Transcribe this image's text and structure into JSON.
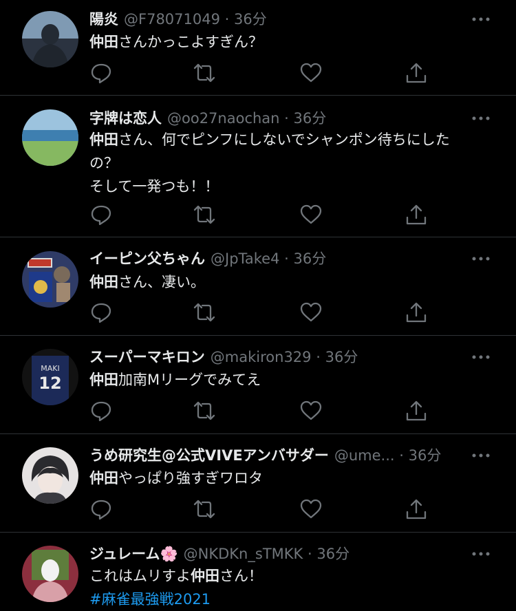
{
  "tweets": [
    {
      "name": "陽炎",
      "handle": "@F78071049",
      "time": "36分",
      "lines": [
        [
          {
            "t": "仲田",
            "b": true
          },
          {
            "t": "さんかっこよすぎん？"
          }
        ]
      ],
      "avatar_color": "#3b4654"
    },
    {
      "name": "字牌は恋人",
      "handle": "@oo27naochan",
      "time": "36分",
      "lines": [
        [
          {
            "t": "仲田",
            "b": true
          },
          {
            "t": "さん、何でピンフにしないでシャンポン待ちにした"
          }
        ],
        [
          {
            "t": "の？"
          }
        ],
        [
          {
            "t": "そして一発つも！！"
          }
        ]
      ],
      "avatar_color": "#6fa6c8"
    },
    {
      "name": "イーピン父ちゃん",
      "handle": "@JpTake4",
      "time": "36分",
      "lines": [
        [
          {
            "t": "仲田",
            "b": true
          },
          {
            "t": "さん、凄い。"
          }
        ]
      ],
      "avatar_color": "#1e3a8a"
    },
    {
      "name": "スーパーマキロン",
      "handle": "@makiron329",
      "time": "36分",
      "lines": [
        [
          {
            "t": "仲田",
            "b": true
          },
          {
            "t": "加南Mリーグでみてえ"
          }
        ]
      ],
      "avatar_color": "#1c2a58",
      "avatar_text": "MAKI 12"
    },
    {
      "name": "うめ研究生@公式VIVEアンバサダー",
      "handle": "@ume...",
      "time": "36分",
      "lines": [
        [
          {
            "t": "仲田",
            "b": true
          },
          {
            "t": "やっぱり強すぎワロタ"
          }
        ]
      ],
      "avatar_color": "#d9d6d6"
    },
    {
      "name": "ジュレーム🌸",
      "handle": "@NKDKn_sTMKK",
      "time": "36分",
      "lines": [
        [
          {
            "t": "これはムリすよ"
          },
          {
            "t": "仲田",
            "b": true
          },
          {
            "t": "さん！"
          }
        ],
        [
          {
            "t": "#麻雀最強戦2021",
            "h": true
          }
        ]
      ],
      "avatar_color": "#b24b58"
    }
  ],
  "separator": "·",
  "colors": {
    "background": "#000000",
    "text": "#e7e9ea",
    "secondary": "#71767b",
    "link": "#1d9bf0",
    "divider": "#2f3336"
  },
  "icons": [
    "reply-icon",
    "retweet-icon",
    "like-icon",
    "share-icon",
    "more-icon"
  ]
}
